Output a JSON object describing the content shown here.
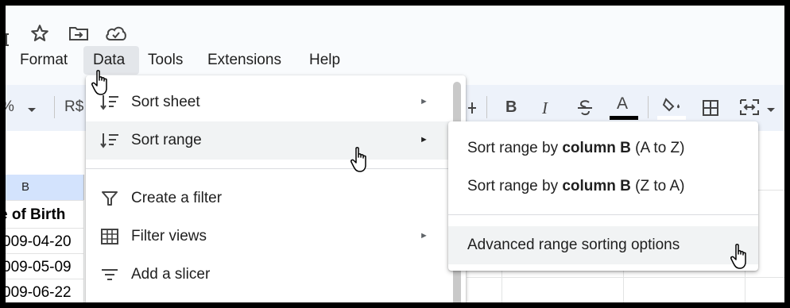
{
  "menubar": {
    "items": [
      "Format",
      "Data",
      "Tools",
      "Extensions",
      "Help"
    ],
    "active": "Data"
  },
  "toolbar": {
    "percent": "%",
    "currency": "R$",
    "bold": "B",
    "italic": "I",
    "strike": "S",
    "text_color": "A"
  },
  "sheet": {
    "column_header": "B",
    "header_cell": "e of Birth",
    "cells": [
      "009-04-20",
      "009-05-09",
      "009-06-22"
    ]
  },
  "data_menu": {
    "items": [
      {
        "label": "Sort sheet",
        "icon": "sort-icon",
        "has_submenu": true
      },
      {
        "label": "Sort range",
        "icon": "sort-icon",
        "has_submenu": true,
        "highlighted": true
      },
      {
        "label": "Create a filter",
        "icon": "filter-icon",
        "has_submenu": false
      },
      {
        "label": "Filter views",
        "icon": "filter-views-icon",
        "has_submenu": true
      },
      {
        "label": "Add a slicer",
        "icon": "slicer-icon",
        "has_submenu": false
      }
    ],
    "submenu_arrow": "►"
  },
  "sort_range_submenu": {
    "az": {
      "prefix": "Sort range by ",
      "bold": "column B",
      "suffix": " (A to Z)"
    },
    "za": {
      "prefix": "Sort range by ",
      "bold": "column B",
      "suffix": " (Z to A)"
    },
    "advanced": "Advanced range sorting options"
  },
  "colors": {
    "menu_highlight": "#f1f3f4",
    "column_header_selected": "#d3e3fd",
    "toolbar_bg": "#edf2fa"
  }
}
